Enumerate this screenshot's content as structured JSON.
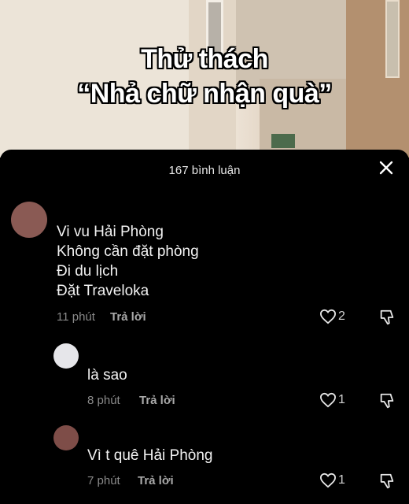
{
  "overlay": {
    "title_line1": "Thử thách",
    "title_line2": "“Nhả chữ nhận quà”"
  },
  "sheet": {
    "comment_count": "167 bình luận",
    "close_icon": "close-icon"
  },
  "comments": [
    {
      "lines": [
        "Vi vu Hải Phòng",
        "Không cần đặt phòng",
        "Đi du lịch",
        "Đặt Traveloka"
      ],
      "time": "11 phút",
      "reply_label": "Trả lời",
      "likes": "2",
      "avatar_color": "#8a5a54"
    },
    {
      "lines": [
        "là sao"
      ],
      "time": "8 phút",
      "reply_label": "Trả lời",
      "likes": "1",
      "avatar_color": "#e6e6ea"
    },
    {
      "lines": [
        "Vì t quê Hải Phòng"
      ],
      "time": "7 phút",
      "reply_label": "Trả lời",
      "likes": "1",
      "avatar_color": "#7e4d48"
    }
  ],
  "icons": [
    "heart-icon",
    "dislike-icon",
    "close-icon"
  ]
}
